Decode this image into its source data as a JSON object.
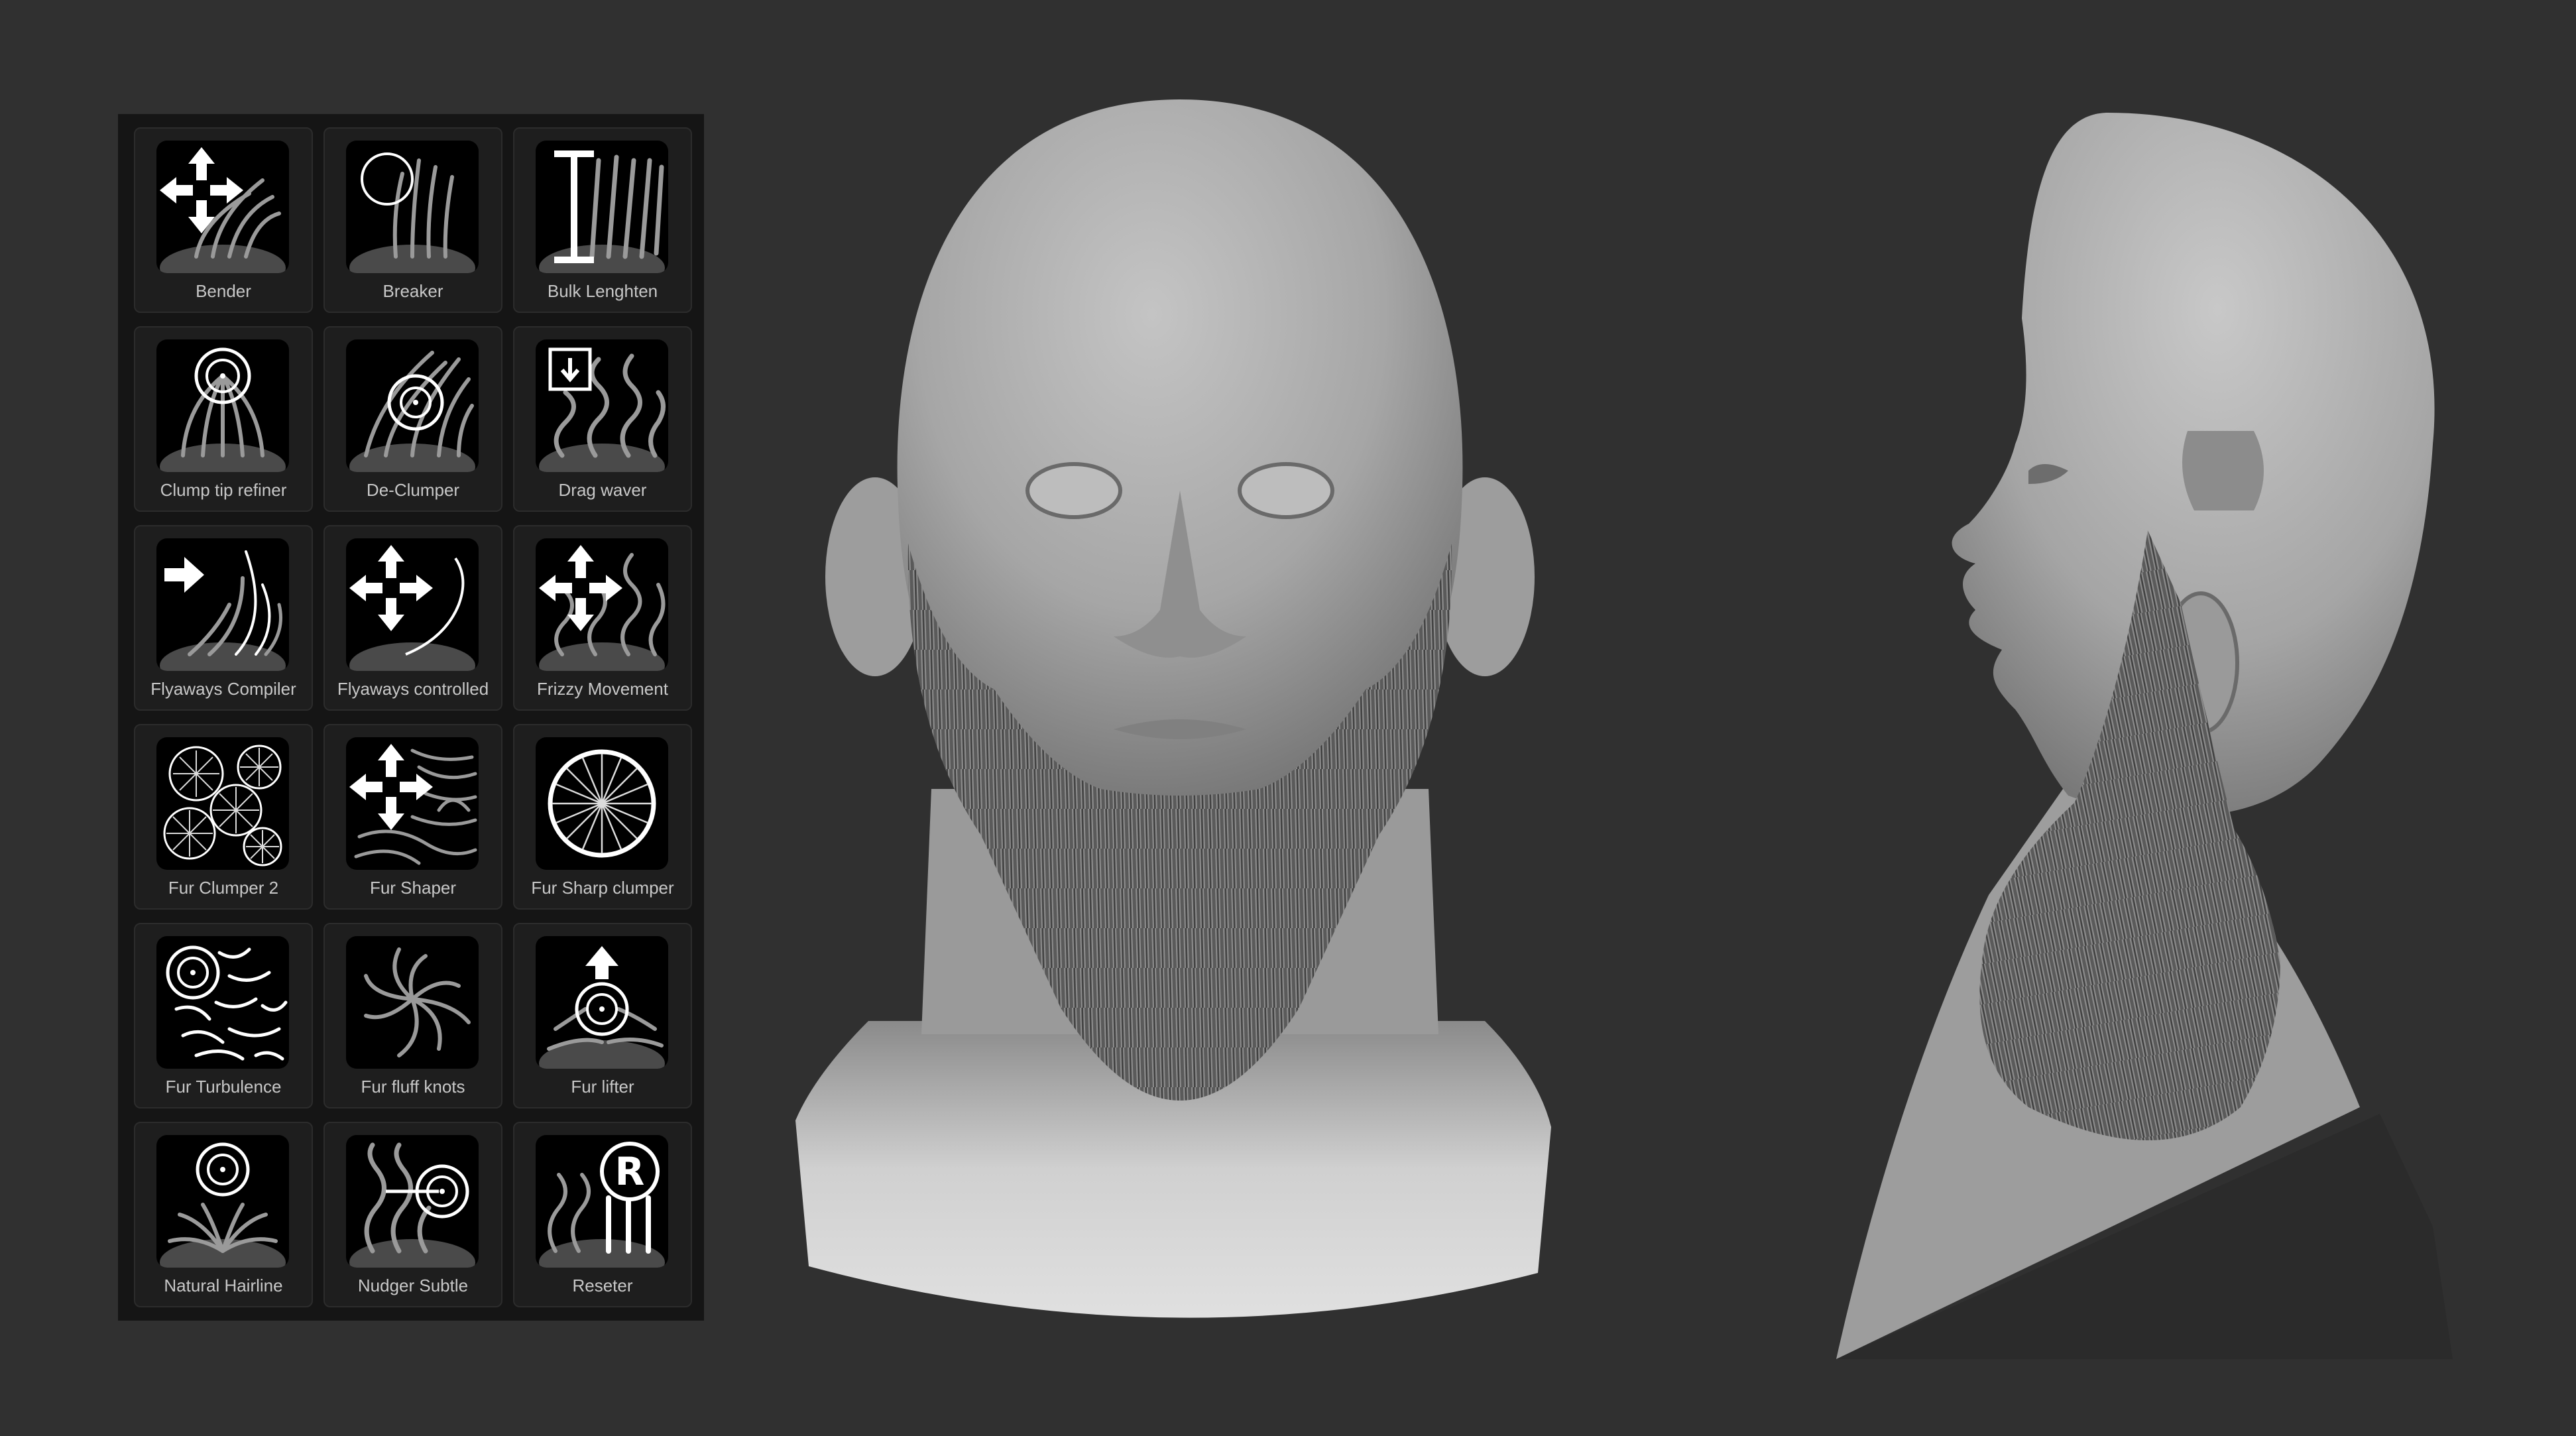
{
  "brush_palette": {
    "tiles": [
      {
        "label": "Bender",
        "icon": "bender-icon"
      },
      {
        "label": "Breaker",
        "icon": "breaker-icon"
      },
      {
        "label": "Bulk Lenghten",
        "icon": "bulk-lengthen-icon"
      },
      {
        "label": "Clump tip refiner",
        "icon": "clump-tip-refiner-icon"
      },
      {
        "label": "De-Clumper",
        "icon": "de-clumper-icon"
      },
      {
        "label": "Drag waver",
        "icon": "drag-waver-icon"
      },
      {
        "label": "Flyaways Compiler",
        "icon": "flyaways-compiler-icon"
      },
      {
        "label": "Flyaways controlled",
        "icon": "flyaways-controlled-icon"
      },
      {
        "label": "Frizzy Movement",
        "icon": "frizzy-movement-icon"
      },
      {
        "label": "Fur Clumper 2",
        "icon": "fur-clumper-icon"
      },
      {
        "label": "Fur Shaper",
        "icon": "fur-shaper-icon"
      },
      {
        "label": "Fur Sharp clumper",
        "icon": "fur-sharp-clumper-icon"
      },
      {
        "label": "Fur Turbulence",
        "icon": "fur-turbulence-icon"
      },
      {
        "label": "Fur fluff knots",
        "icon": "fur-fluff-knots-icon"
      },
      {
        "label": "Fur lifter",
        "icon": "fur-lifter-icon"
      },
      {
        "label": "Natural Hairline",
        "icon": "natural-hairline-icon"
      },
      {
        "label": "Nudger Subtle",
        "icon": "nudger-subtle-icon"
      },
      {
        "label": "Reseter",
        "icon": "reseter-icon",
        "badge": "R"
      }
    ]
  },
  "colors": {
    "background": "#303030",
    "palette_bg": "#151515",
    "tile_bg": "#1e1e1e",
    "label": "#c8c8c8",
    "skin": "#a9a9a9",
    "beard": "#6e6e6e"
  }
}
